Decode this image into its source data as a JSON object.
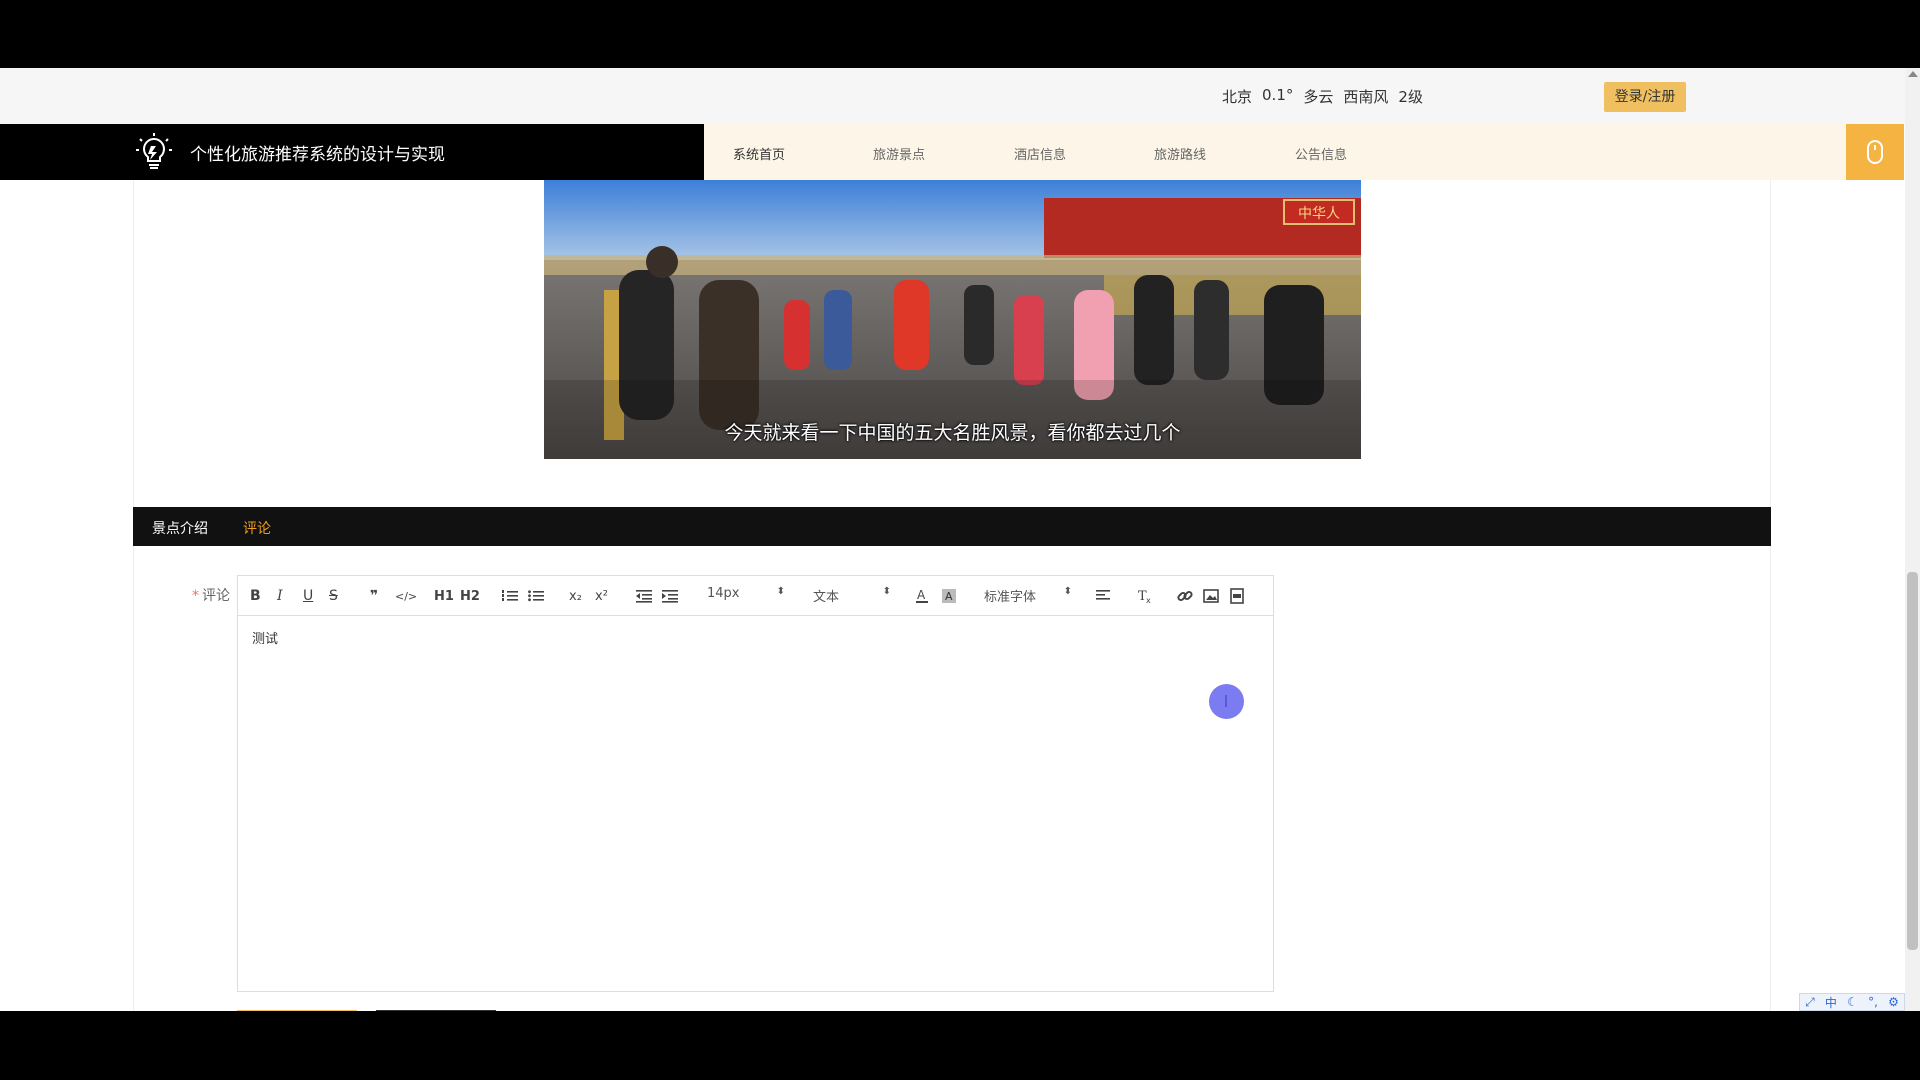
{
  "topbar": {
    "weather": {
      "city": "北京",
      "temp": "0.1°",
      "condition": "多云",
      "wind_dir": "西南风",
      "wind_level": "2级"
    },
    "login_label": "登录/注册"
  },
  "header": {
    "brand_title": "个性化旅游推荐系统的设计与实现",
    "nav": [
      {
        "label": "系统首页"
      },
      {
        "label": "旅游景点"
      },
      {
        "label": "酒店信息"
      },
      {
        "label": "旅游路线"
      },
      {
        "label": "公告信息"
      }
    ]
  },
  "video": {
    "subtitle": "今天就来看一下中国的五大名胜风景，看你都去过几个",
    "sign_text": "中华人"
  },
  "tabs": [
    {
      "label": "景点介绍"
    },
    {
      "label": "评论",
      "active": true
    }
  ],
  "form": {
    "required_mark": "*",
    "comment_label": "评论",
    "editor": {
      "content": "测试",
      "font_size": "14px",
      "block_format": "文本",
      "font_family": "标准字体",
      "toolbar": {
        "bold": "B",
        "italic": "I",
        "underline": "U",
        "strike": "S",
        "quote": "❞",
        "code": "</>",
        "h1": "H1",
        "h2": "H2",
        "sub": "x₂",
        "sup": "x²"
      }
    }
  },
  "ime": {
    "lang": "中"
  }
}
